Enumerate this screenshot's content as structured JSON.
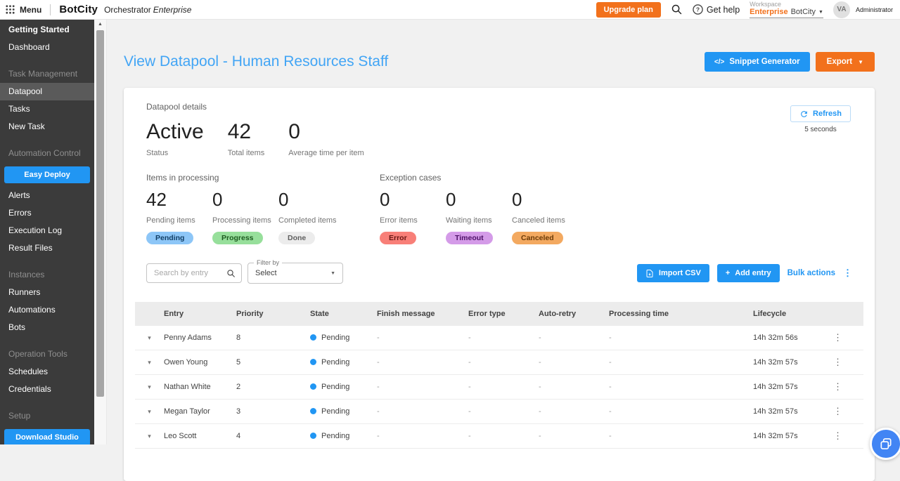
{
  "topbar": {
    "menu_label": "Menu",
    "logo": "BotCity",
    "product_name": "Orchestrator",
    "product_edition": "Enterprise",
    "upgrade_button": "Upgrade plan",
    "get_help_label": "Get help",
    "workspace": {
      "label": "Workspace",
      "edition": "Enterprise",
      "name": "BotCity"
    },
    "user": {
      "initials": "VA",
      "role": "Administrator"
    }
  },
  "sidebar": {
    "items": [
      {
        "type": "section-bright",
        "label": "Getting Started"
      },
      {
        "type": "item",
        "label": "Dashboard"
      },
      {
        "type": "section",
        "label": "Task Management"
      },
      {
        "type": "item",
        "label": "Datapool",
        "active": true
      },
      {
        "type": "item",
        "label": "Tasks"
      },
      {
        "type": "item",
        "label": "New Task"
      },
      {
        "type": "section",
        "label": "Automation Control"
      },
      {
        "type": "button",
        "label": "Easy Deploy"
      },
      {
        "type": "item",
        "label": "Alerts"
      },
      {
        "type": "item",
        "label": "Errors"
      },
      {
        "type": "item",
        "label": "Execution Log"
      },
      {
        "type": "item",
        "label": "Result Files"
      },
      {
        "type": "section",
        "label": "Instances"
      },
      {
        "type": "item",
        "label": "Runners"
      },
      {
        "type": "item",
        "label": "Automations"
      },
      {
        "type": "item",
        "label": "Bots"
      },
      {
        "type": "section",
        "label": "Operation Tools"
      },
      {
        "type": "item",
        "label": "Schedules"
      },
      {
        "type": "item",
        "label": "Credentials"
      },
      {
        "type": "section",
        "label": "Setup"
      },
      {
        "type": "button",
        "label": "Download Studio"
      }
    ]
  },
  "page": {
    "title": "View Datapool - Human Resources Staff",
    "snippet_button": "Snippet Generator",
    "snippet_icon": "</>",
    "export_button": "Export"
  },
  "details": {
    "label": "Datapool details",
    "stats": [
      {
        "value": "Active",
        "label": "Status"
      },
      {
        "value": "42",
        "label": "Total items"
      },
      {
        "value": "0",
        "label": "Average time per item"
      }
    ],
    "refresh": {
      "label": "Refresh",
      "interval": "5 seconds"
    }
  },
  "processing": {
    "label": "Items in processing",
    "stats": [
      {
        "value": "42",
        "label": "Pending items",
        "badge": "Pending",
        "badge_bg": "#8DC6F7",
        "badge_fg": "#123F66"
      },
      {
        "value": "0",
        "label": "Processing items",
        "badge": "Progress",
        "badge_bg": "#97DF9B",
        "badge_fg": "#1D5B20"
      },
      {
        "value": "0",
        "label": "Completed items",
        "badge": "Done",
        "badge_bg": "#ECECEC",
        "badge_fg": "#5F5F5F"
      }
    ]
  },
  "exceptions": {
    "label": "Exception cases",
    "stats": [
      {
        "value": "0",
        "label": "Error items",
        "badge": "Error",
        "badge_bg": "#F87F78",
        "badge_fg": "#671512"
      },
      {
        "value": "0",
        "label": "Waiting items",
        "badge": "Timeout",
        "badge_bg": "#D49BE8",
        "badge_fg": "#4E1168"
      },
      {
        "value": "0",
        "label": "Canceled items",
        "badge": "Canceled",
        "badge_bg": "#F3A960",
        "badge_fg": "#6B3A07"
      }
    ]
  },
  "filters": {
    "search_placeholder": "Search by entry",
    "filter_label": "Filter by",
    "filter_value": "Select",
    "import_button": "Import CSV",
    "add_button": "Add entry",
    "bulk_button": "Bulk actions"
  },
  "table": {
    "columns": [
      "Entry",
      "Priority",
      "State",
      "Finish message",
      "Error type",
      "Auto-retry",
      "Processing time",
      "Lifecycle"
    ],
    "rows": [
      {
        "entry": "Penny Adams",
        "priority": "8",
        "state": "Pending",
        "finish_message": "-",
        "error_type": "-",
        "auto_retry": "-",
        "processing_time": "-",
        "lifecycle": "14h 32m 56s"
      },
      {
        "entry": "Owen Young",
        "priority": "5",
        "state": "Pending",
        "finish_message": "-",
        "error_type": "-",
        "auto_retry": "-",
        "processing_time": "-",
        "lifecycle": "14h 32m 57s"
      },
      {
        "entry": "Nathan White",
        "priority": "2",
        "state": "Pending",
        "finish_message": "-",
        "error_type": "-",
        "auto_retry": "-",
        "processing_time": "-",
        "lifecycle": "14h 32m 57s"
      },
      {
        "entry": "Megan Taylor",
        "priority": "3",
        "state": "Pending",
        "finish_message": "-",
        "error_type": "-",
        "auto_retry": "-",
        "processing_time": "-",
        "lifecycle": "14h 32m 57s"
      },
      {
        "entry": "Leo Scott",
        "priority": "4",
        "state": "Pending",
        "finish_message": "-",
        "error_type": "-",
        "auto_retry": "-",
        "processing_time": "-",
        "lifecycle": "14h 32m 57s"
      }
    ],
    "state_dot_color": "#2196F3"
  },
  "icons": {
    "caret_down": "▾",
    "dropdown_caret": "▼",
    "kebab": "⋮",
    "scroll_up_arrow": "▲",
    "plus": "+"
  },
  "colors": {
    "accent_blue": "#2196F3",
    "accent_orange": "#F2711C",
    "title_blue": "#42A5F5",
    "sidebar_bg": "#3b3b3b"
  }
}
